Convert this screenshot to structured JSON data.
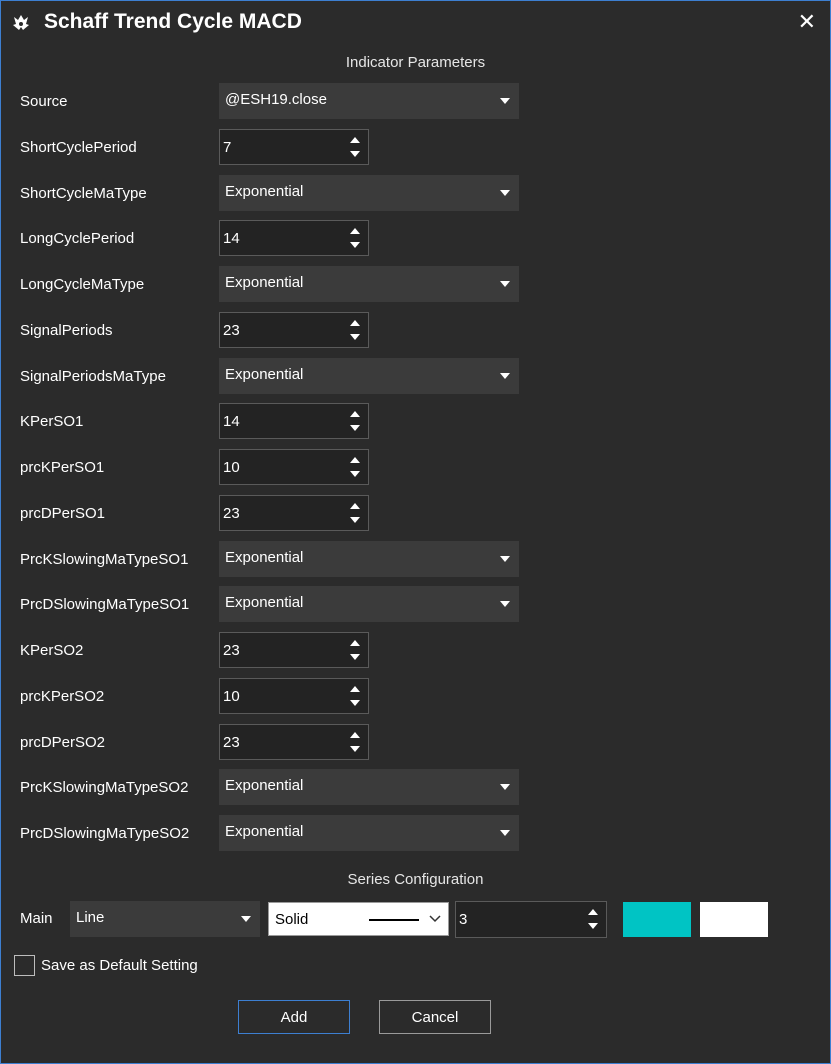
{
  "window": {
    "title": "Schaff Trend Cycle MACD",
    "close_glyph": "✕",
    "icon": "app-logo-icon"
  },
  "sections": {
    "indicator": "Indicator Parameters",
    "series": "Series Configuration"
  },
  "params": [
    {
      "label": "Source",
      "type": "dropdown",
      "value": "@ESH19.close"
    },
    {
      "label": "ShortCyclePeriod",
      "type": "spinner",
      "value": "7"
    },
    {
      "label": "ShortCycleMaType",
      "type": "dropdown",
      "value": "Exponential"
    },
    {
      "label": "LongCyclePeriod",
      "type": "spinner",
      "value": "14"
    },
    {
      "label": "LongCycleMaType",
      "type": "dropdown",
      "value": "Exponential"
    },
    {
      "label": "SignalPeriods",
      "type": "spinner",
      "value": "23"
    },
    {
      "label": "SignalPeriodsMaType",
      "type": "dropdown",
      "value": "Exponential"
    },
    {
      "label": "KPerSO1",
      "type": "spinner",
      "value": "14"
    },
    {
      "label": "prcKPerSO1",
      "type": "spinner",
      "value": "10"
    },
    {
      "label": "prcDPerSO1",
      "type": "spinner",
      "value": "23"
    },
    {
      "label": "PrcKSlowingMaTypeSO1",
      "type": "dropdown",
      "value": "Exponential"
    },
    {
      "label": "PrcDSlowingMaTypeSO1",
      "type": "dropdown",
      "value": "Exponential"
    },
    {
      "label": "KPerSO2",
      "type": "spinner",
      "value": "23"
    },
    {
      "label": "prcKPerSO2",
      "type": "spinner",
      "value": "10"
    },
    {
      "label": "prcDPerSO2",
      "type": "spinner",
      "value": "23"
    },
    {
      "label": "PrcKSlowingMaTypeSO2",
      "type": "dropdown",
      "value": "Exponential"
    },
    {
      "label": "PrcDSlowingMaTypeSO2",
      "type": "dropdown",
      "value": "Exponential"
    }
  ],
  "series": {
    "name": "Main",
    "type": "Line",
    "line_style": "Solid",
    "width": "3",
    "line_color": "#00c4c4",
    "fill_color": "#ffffff"
  },
  "checkbox": {
    "label": "Save as Default Setting",
    "checked": false
  },
  "buttons": {
    "add": "Add",
    "cancel": "Cancel"
  },
  "colors": {
    "background": "#2b2b2b",
    "control": "#3b3b3b",
    "accent": "#3d7fd1"
  }
}
